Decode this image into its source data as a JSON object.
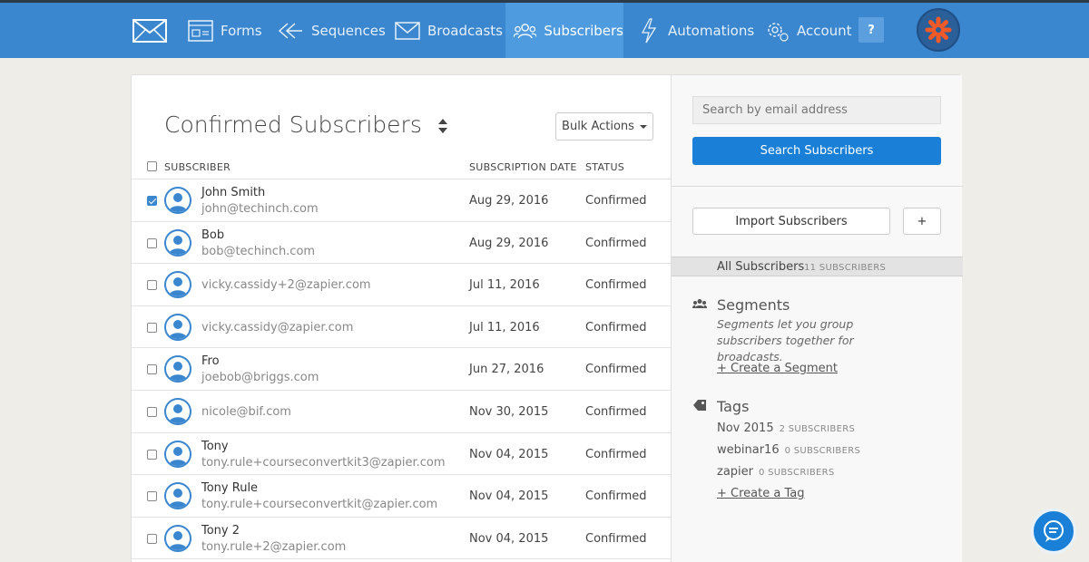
{
  "nav": {
    "items": [
      {
        "label": "Forms",
        "icon": "form-icon"
      },
      {
        "label": "Sequences",
        "icon": "sequence-icon"
      },
      {
        "label": "Broadcasts",
        "icon": "envelope-icon"
      },
      {
        "label": "Subscribers",
        "icon": "users-icon"
      },
      {
        "label": "Automations",
        "icon": "lightning-icon"
      },
      {
        "label": "Account",
        "icon": "gear-icon"
      }
    ],
    "help_label": "?",
    "active": "Subscribers"
  },
  "header": {
    "title": "Confirmed Subscribers",
    "bulk_actions_label": "Bulk Actions"
  },
  "table": {
    "columns": [
      "SUBSCRIBER",
      "SUBSCRIPTION DATE",
      "STATUS"
    ],
    "rows": [
      {
        "name": "John Smith",
        "email": "john@techinch.com",
        "date": "Aug 29, 2016",
        "status": "Confirmed",
        "checked": true
      },
      {
        "name": "Bob",
        "email": "bob@techinch.com",
        "date": "Aug 29, 2016",
        "status": "Confirmed",
        "checked": false
      },
      {
        "name": "",
        "email": "vicky.cassidy+2@zapier.com",
        "date": "Jul 11, 2016",
        "status": "Confirmed",
        "checked": false
      },
      {
        "name": "",
        "email": "vicky.cassidy@zapier.com",
        "date": "Jul 11, 2016",
        "status": "Confirmed",
        "checked": false
      },
      {
        "name": "Fro",
        "email": "joebob@briggs.com",
        "date": "Jun 27, 2016",
        "status": "Confirmed",
        "checked": false
      },
      {
        "name": "",
        "email": "nicole@bif.com",
        "date": "Nov 30, 2015",
        "status": "Confirmed",
        "checked": false
      },
      {
        "name": "Tony",
        "email": "tony.rule+courseconvertkit3@zapier.com",
        "date": "Nov 04, 2015",
        "status": "Confirmed",
        "checked": false
      },
      {
        "name": "Tony Rule",
        "email": "tony.rule+courseconvertkit@zapier.com",
        "date": "Nov 04, 2015",
        "status": "Confirmed",
        "checked": false
      },
      {
        "name": "Tony 2",
        "email": "tony.rule+2@zapier.com",
        "date": "Nov 04, 2015",
        "status": "Confirmed",
        "checked": false
      }
    ]
  },
  "sidebar": {
    "search_placeholder": "Search by email address",
    "search_button": "Search Subscribers",
    "import_button": "Import Subscribers",
    "add_button": "+",
    "all_subscribers": {
      "label": "All Subscribers",
      "count": "11 SUBSCRIBERS"
    },
    "segments": {
      "title": "Segments",
      "description": "Segments let you group subscribers together for broadcasts.",
      "create_link": "+ Create a Segment"
    },
    "tags": {
      "title": "Tags",
      "items": [
        {
          "name": "Nov 2015",
          "count": "2 SUBSCRIBERS"
        },
        {
          "name": "webinar16",
          "count": "0 SUBSCRIBERS"
        },
        {
          "name": "zapier",
          "count": "0 SUBSCRIBERS"
        }
      ],
      "create_link": "+ Create a Tag"
    }
  },
  "colors": {
    "nav_bg": "#3a86cf",
    "nav_active": "#4f9be0",
    "primary_button": "#1a7fd6",
    "logo_accent": "#f05a28"
  }
}
